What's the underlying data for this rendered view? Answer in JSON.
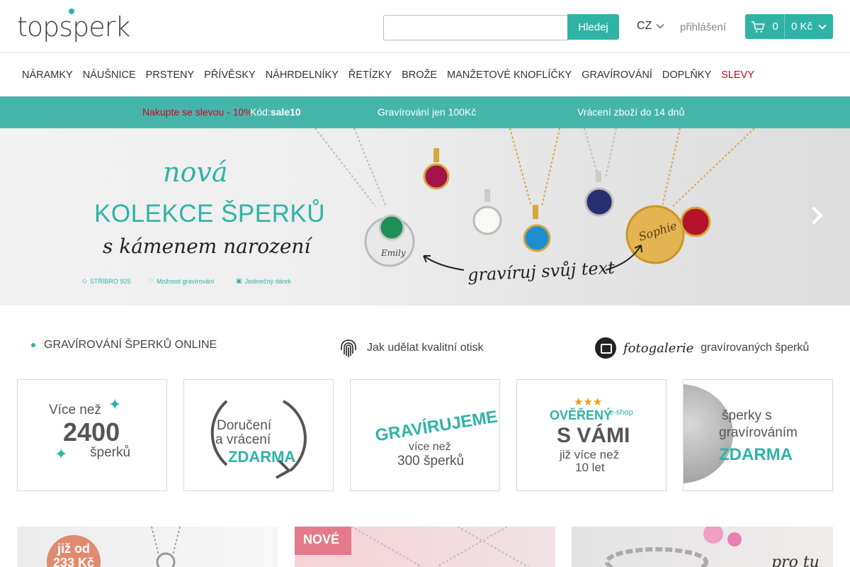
{
  "header": {
    "logo": "topsperk",
    "search": {
      "value": "",
      "placeholder": "",
      "button": "Hledej"
    },
    "language": "CZ",
    "login": "přihlášení",
    "cart": {
      "count": "0",
      "total": "0 Kč"
    }
  },
  "nav": {
    "items": [
      {
        "label": "NÁRAMKY"
      },
      {
        "label": "NÁUŠNICE"
      },
      {
        "label": "PRSTENY"
      },
      {
        "label": "PŘÍVĚSKY"
      },
      {
        "label": "NÁHRDELNÍKY"
      },
      {
        "label": "ŘETÍZKY"
      },
      {
        "label": "BROŽE"
      },
      {
        "label": "MANŽETOVÉ KNOFLÍČKY"
      },
      {
        "label": "GRAVÍROVÁNÍ"
      },
      {
        "label": "DOPLŇKY"
      },
      {
        "label": "SLEVY"
      }
    ]
  },
  "promo": {
    "discount": "Nakupte se slevou - 10%",
    "code_label": "Kód:",
    "code": "sale10",
    "engraving": "Gravírování jen 100Kč",
    "returns": "Vrácení zboží do 14 dnů"
  },
  "hero": {
    "line1": "nová",
    "line2": "KOLEKCE ŠPERKŮ",
    "line3": "s kámenem narození",
    "features": [
      "STŘÍBRO 925",
      "Možnost gravírování",
      "Jedinečný dárek"
    ],
    "engrave_text": "gravíruj svůj text",
    "name1": "Emily",
    "name2": "Sophie"
  },
  "info": {
    "engraving_online": "GRAVÍROVÁNÍ ŠPERKŮ ONLINE",
    "fingerprint": "Jak udělat kvalitní otisk",
    "fotogalerie": "fotogalerie",
    "gallery": "gravírovaných šperků"
  },
  "boxes": {
    "b1": {
      "top": "Více než",
      "big": "2400",
      "bottom": "šperků"
    },
    "b2": {
      "l1": "Doručení",
      "l2": "a vrácení",
      "l3": "ZDARMA"
    },
    "b3": {
      "l1": "GRAVÍRUJEME",
      "l2": "více než",
      "l3": "300 šperků"
    },
    "b4": {
      "stars": "★★★",
      "l1": "OVĚŘENÝ",
      "eshop": "e-shop",
      "l2": "S VÁMI",
      "l3": "již více než",
      "l4": "10 let"
    },
    "b5": {
      "l1": "šperky s",
      "l2": "gravírováním",
      "l3": "ZDARMA"
    }
  },
  "banners": {
    "b1_tag": "již od 233 Kč",
    "b2_tag": "NOVÉ",
    "b3_text": "pro tu"
  },
  "colors": {
    "accent": "#2fb3a6",
    "sale": "#d0021b"
  }
}
